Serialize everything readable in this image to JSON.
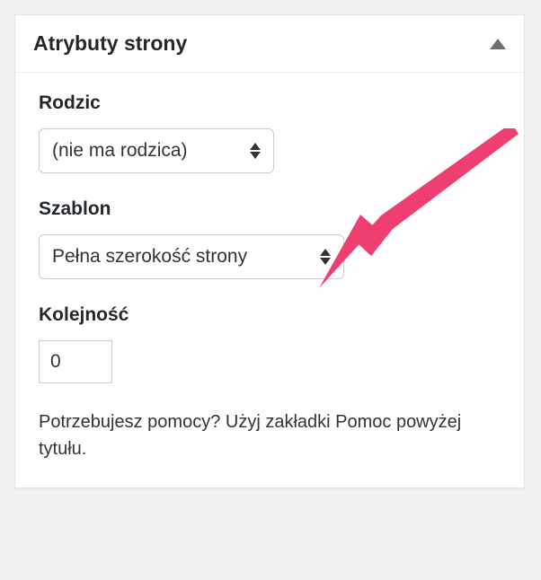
{
  "panel": {
    "title": "Atrybuty strony"
  },
  "fields": {
    "parent": {
      "label": "Rodzic",
      "value": "(nie ma rodzica)"
    },
    "template": {
      "label": "Szablon",
      "value": "Pełna szerokość strony"
    },
    "order": {
      "label": "Kolejność",
      "value": "0"
    }
  },
  "help": "Potrzebujesz pomocy? Użyj zakładki Pomoc powyżej tytułu.",
  "colors": {
    "arrow": "#ef3f70"
  }
}
